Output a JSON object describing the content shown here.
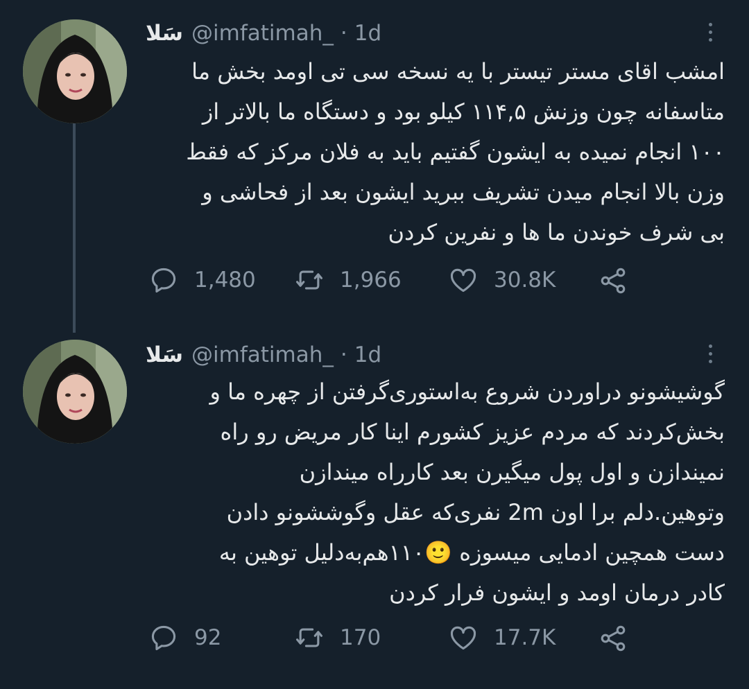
{
  "tweets": [
    {
      "display_name": "سَلا",
      "handle": "@imfatimah_",
      "separator": "·",
      "time": "1d",
      "text_lines": [
        "امشب اقای مستر تیستر با یه نسخه سی تی اومد بخش ما",
        "متاسفانه چون وزنش ۱۱۴,۵ کیلو بود و دستگاه ما بالاتر از",
        "۱۰۰ انجام نمیده به ایشون گفتیم باید به فلان مرکز که فقط",
        "وزن بالا انجام میدن تشریف ببرید ایشون بعد از فحاشی و",
        "بی شرف خوندن ما ها و نفرین کردن"
      ],
      "replies": "1,480",
      "retweets": "1,966",
      "likes": "30.8K"
    },
    {
      "display_name": "سَلا",
      "handle": "@imfatimah_",
      "separator": "·",
      "time": "1d",
      "text_lines": [
        "گوشیشونو دراوردن شروع به‌استوری‌گرفتن از چهره ما و",
        "بخش‌کردند که مردم عزیز کشورم اینا کار مریض رو راه",
        "نمیندازن و اول پول میگیرن بعد کارراه میندازن",
        "وتوهین.دلم برا اون 2m نفری‌که عقل وگوششونو دادن",
        "دست همچین ادمایی میسوزه 🙂۱۱۰هم‌به‌دلیل توهین به",
        "کادر درمان اومد و ایشون فرار کردن"
      ],
      "replies": "92",
      "retweets": "170",
      "likes": "17.7K"
    }
  ],
  "icons": {
    "reply": "reply-icon",
    "retweet": "retweet-icon",
    "like": "heart-icon",
    "share": "share-icon",
    "more": "more-vertical-icon"
  },
  "colors": {
    "background": "#15202b",
    "text": "#e7e9ea",
    "secondary": "#8b98a5",
    "thread_line": "#3c4b5a"
  }
}
